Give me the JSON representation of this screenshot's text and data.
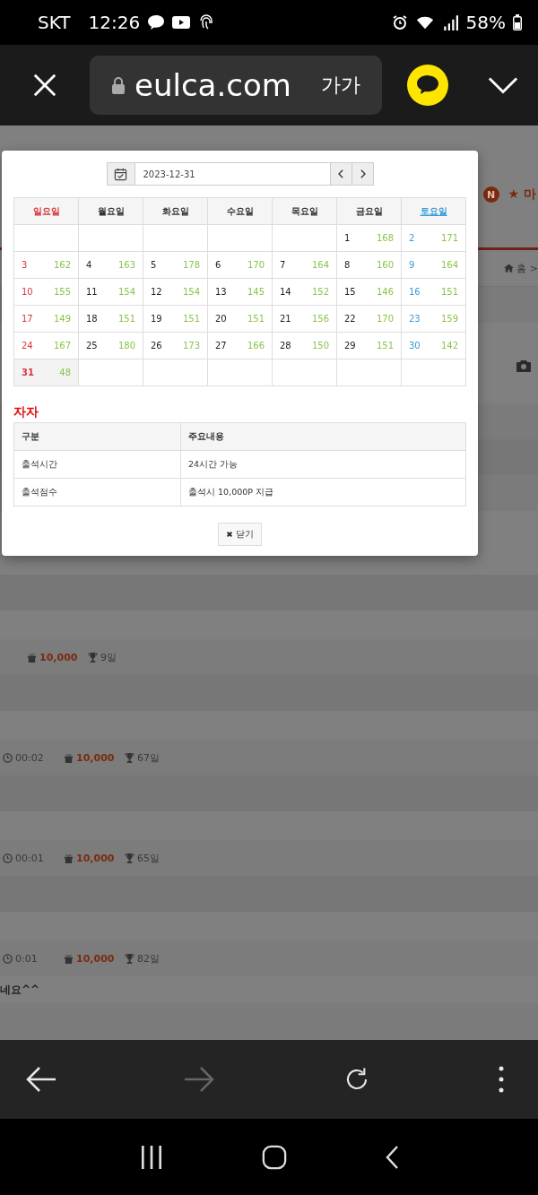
{
  "status_bar": {
    "carrier": "SKT",
    "time": "12:26",
    "battery": "58%"
  },
  "browser": {
    "url": "eulca.com",
    "text_size_button": "가가"
  },
  "page_header": {
    "new_badge": "N",
    "my_link": "★ 마",
    "breadcrumb": "홈 >"
  },
  "posts": [
    {
      "points": "10,000",
      "days": "9일"
    },
    {
      "time": "00:02",
      "points": "10,000",
      "days": "67일"
    },
    {
      "time": "00:01",
      "points": "10,000",
      "days": "65일"
    },
    {
      "time": "0:01",
      "points": "10,000",
      "days": "82일"
    }
  ],
  "comment": "네요^^",
  "modal": {
    "date": "2023-12-31",
    "weekdays": [
      {
        "label": "일요일",
        "kind": "sunday"
      },
      {
        "label": "월요일",
        "kind": "weekday"
      },
      {
        "label": "화요일",
        "kind": "weekday"
      },
      {
        "label": "수요일",
        "kind": "weekday"
      },
      {
        "label": "목요일",
        "kind": "weekday"
      },
      {
        "label": "금요일",
        "kind": "weekday"
      },
      {
        "label": "토요일",
        "kind": "saturday"
      }
    ],
    "weeks": [
      [
        {
          "kind": "blank"
        },
        {
          "kind": "blank"
        },
        {
          "kind": "blank"
        },
        {
          "kind": "blank"
        },
        {
          "kind": "blank"
        },
        {
          "kind": "weekday",
          "day": "1",
          "count": "168",
          "selected": false
        },
        {
          "kind": "saturday",
          "day": "2",
          "count": "171",
          "selected": false
        }
      ],
      [
        {
          "kind": "sunday",
          "day": "3",
          "count": "162",
          "selected": false
        },
        {
          "kind": "weekday",
          "day": "4",
          "count": "163",
          "selected": false
        },
        {
          "kind": "weekday",
          "day": "5",
          "count": "178",
          "selected": false
        },
        {
          "kind": "weekday",
          "day": "6",
          "count": "170",
          "selected": false
        },
        {
          "kind": "weekday",
          "day": "7",
          "count": "164",
          "selected": false
        },
        {
          "kind": "weekday",
          "day": "8",
          "count": "160",
          "selected": false
        },
        {
          "kind": "saturday",
          "day": "9",
          "count": "164",
          "selected": false
        }
      ],
      [
        {
          "kind": "sunday",
          "day": "10",
          "count": "155",
          "selected": false
        },
        {
          "kind": "weekday",
          "day": "11",
          "count": "154",
          "selected": false
        },
        {
          "kind": "weekday",
          "day": "12",
          "count": "154",
          "selected": false
        },
        {
          "kind": "weekday",
          "day": "13",
          "count": "145",
          "selected": false
        },
        {
          "kind": "weekday",
          "day": "14",
          "count": "152",
          "selected": false
        },
        {
          "kind": "weekday",
          "day": "15",
          "count": "146",
          "selected": false
        },
        {
          "kind": "saturday",
          "day": "16",
          "count": "151",
          "selected": false
        }
      ],
      [
        {
          "kind": "sunday",
          "day": "17",
          "count": "149",
          "selected": false
        },
        {
          "kind": "weekday",
          "day": "18",
          "count": "151",
          "selected": false
        },
        {
          "kind": "weekday",
          "day": "19",
          "count": "151",
          "selected": false
        },
        {
          "kind": "weekday",
          "day": "20",
          "count": "151",
          "selected": false
        },
        {
          "kind": "weekday",
          "day": "21",
          "count": "156",
          "selected": false
        },
        {
          "kind": "weekday",
          "day": "22",
          "count": "170",
          "selected": false
        },
        {
          "kind": "saturday",
          "day": "23",
          "count": "159",
          "selected": false
        }
      ],
      [
        {
          "kind": "sunday",
          "day": "24",
          "count": "167",
          "selected": false
        },
        {
          "kind": "weekday",
          "day": "25",
          "count": "180",
          "selected": false
        },
        {
          "kind": "weekday",
          "day": "26",
          "count": "173",
          "selected": false
        },
        {
          "kind": "weekday",
          "day": "27",
          "count": "166",
          "selected": false
        },
        {
          "kind": "weekday",
          "day": "28",
          "count": "150",
          "selected": false
        },
        {
          "kind": "weekday",
          "day": "29",
          "count": "151",
          "selected": false
        },
        {
          "kind": "saturday",
          "day": "30",
          "count": "142",
          "selected": false
        }
      ],
      [
        {
          "kind": "sunday",
          "day": "31",
          "count": "48",
          "selected": true
        },
        {
          "kind": "blank"
        },
        {
          "kind": "blank"
        },
        {
          "kind": "blank"
        },
        {
          "kind": "blank"
        },
        {
          "kind": "blank"
        },
        {
          "kind": "blank"
        }
      ]
    ],
    "section_title": "자자",
    "info_columns": [
      "구분",
      "주요내용"
    ],
    "info_rows": [
      [
        "출석시간",
        "24시간 가능"
      ],
      [
        "출석점수",
        "출석시 10,000P 지급"
      ]
    ],
    "close_button": "닫기"
  },
  "browser_nav": [
    {
      "kind": "back",
      "disabled": false
    },
    {
      "kind": "forward",
      "disabled": true
    },
    {
      "kind": "reload",
      "disabled": false
    },
    {
      "kind": "more",
      "disabled": false
    }
  ]
}
